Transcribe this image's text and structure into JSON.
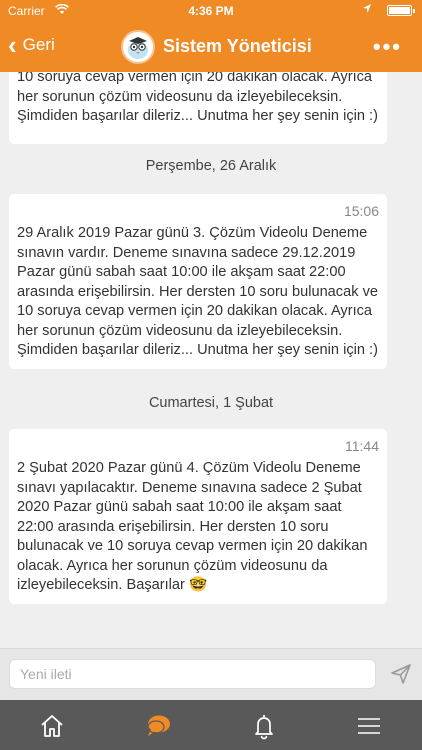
{
  "status_bar": {
    "carrier": "Carrier",
    "time": "4:36 PM"
  },
  "nav": {
    "back_label": "Geri",
    "title": "Sistem Yöneticisi",
    "more_label": "•••"
  },
  "messages": [
    {
      "text": "10 soruya cevap vermen için 20 dakikan olacak. Ayrıca her sorunun çözüm videosunu da izleyebileceksin. Şimdiden başarılar dileriz... Unutma her şey senin için :)"
    },
    {
      "date": "Perşembe, 26 Aralık",
      "time": "15:06",
      "text": "29 Aralık 2019 Pazar günü 3. Çözüm Videolu Deneme sınavın vardır. Deneme sınavına sadece 29.12.2019 Pazar günü sabah saat 10:00 ile akşam saat 22:00 arasında erişebilirsin. Her dersten 10 soru bulunacak ve 10 soruya cevap vermen için 20 dakikan olacak. Ayrıca her sorunun çözüm videosunu da izleyebileceksin. Şimdiden başarılar dileriz... Unutma her şey senin için :)"
    },
    {
      "date": "Cumartesi, 1 Şubat",
      "time": "11:44",
      "text": "2 Şubat 2020 Pazar günü 4. Çözüm Videolu Deneme sınavı yapılacaktır. Deneme sınavına sadece 2 Şubat 2020 Pazar günü sabah saat 10:00 ile akşam saat 22:00 arasında erişebilirsin. Her dersten 10 soru bulunacak ve 10 soruya cevap vermen için 20 dakikan olacak. Ayrıca her sorunun çözüm videosunu da izleyebileceksin. Başarılar 🤓"
    }
  ],
  "composer": {
    "placeholder": "Yeni ileti"
  },
  "tab_bar": {
    "items": [
      "home-icon",
      "chat-icon",
      "bell-icon",
      "menu-icon"
    ],
    "active": "chat-icon"
  },
  "colors": {
    "accent": "#f08a24",
    "tab_bar": "#595959",
    "active_tab": "#f08a24"
  }
}
